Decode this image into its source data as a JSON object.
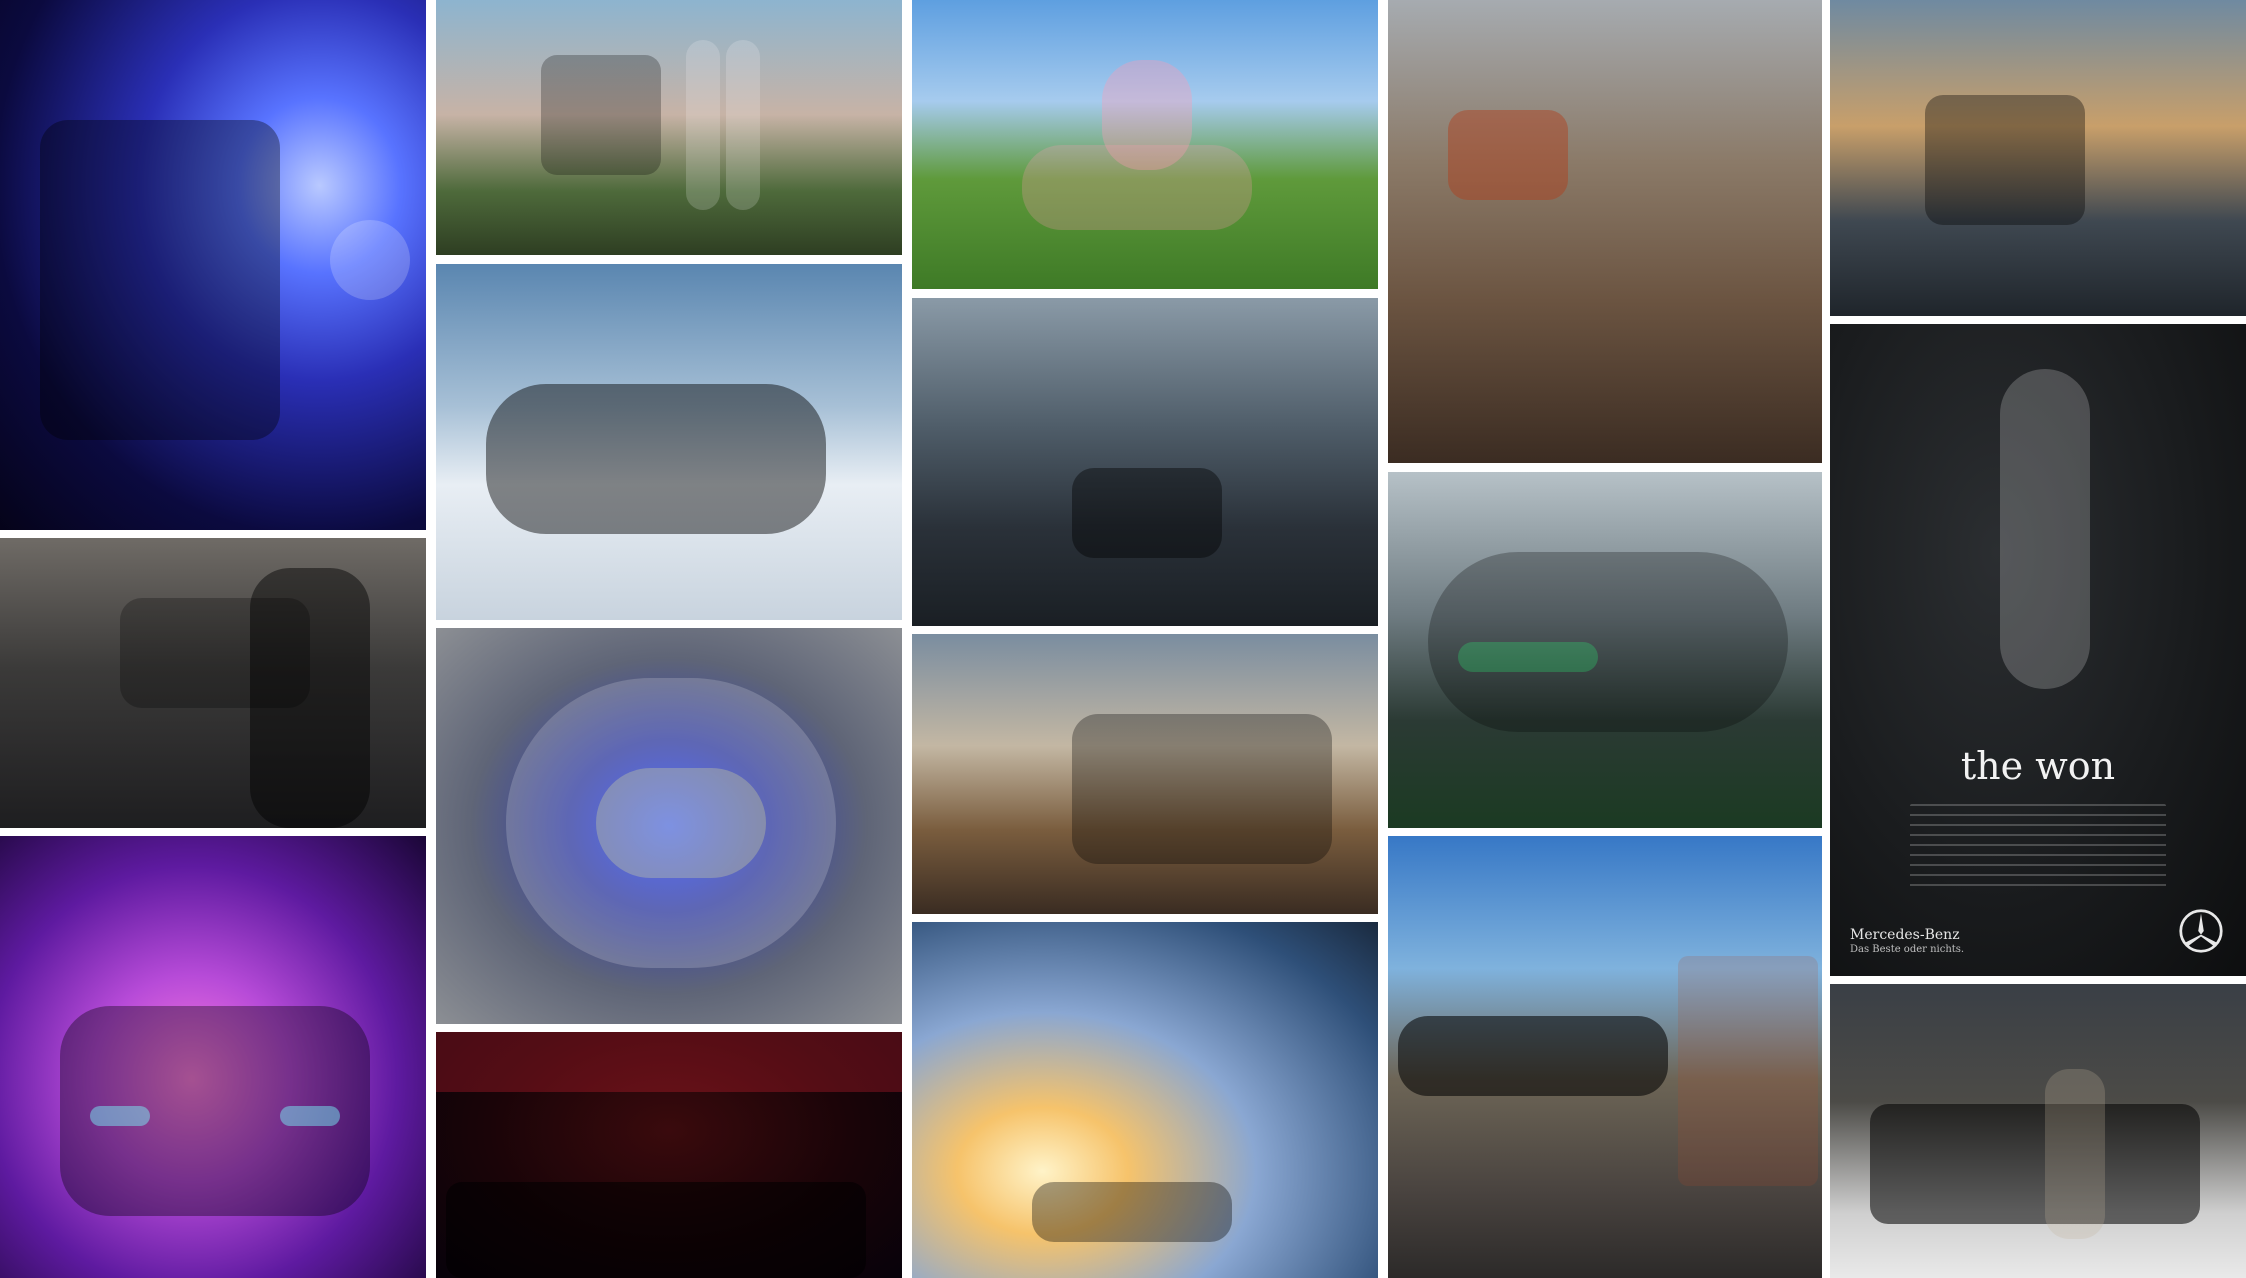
{
  "gallery": {
    "tiles": [
      {
        "id": "t1"
      },
      {
        "id": "t2"
      },
      {
        "id": "t3"
      },
      {
        "id": "t4"
      },
      {
        "id": "t5"
      },
      {
        "id": "t6"
      },
      {
        "id": "t7"
      },
      {
        "id": "t8"
      },
      {
        "id": "t9"
      },
      {
        "id": "t10"
      },
      {
        "id": "t11"
      },
      {
        "id": "t12"
      },
      {
        "id": "t13"
      },
      {
        "id": "t14"
      },
      {
        "id": "t15"
      },
      {
        "id": "t16"
      },
      {
        "id": "t17"
      }
    ]
  },
  "mercedes_ad": {
    "headline": "the won",
    "brand": "Mercedes-Benz",
    "tagline": "Das Beste oder nichts."
  }
}
